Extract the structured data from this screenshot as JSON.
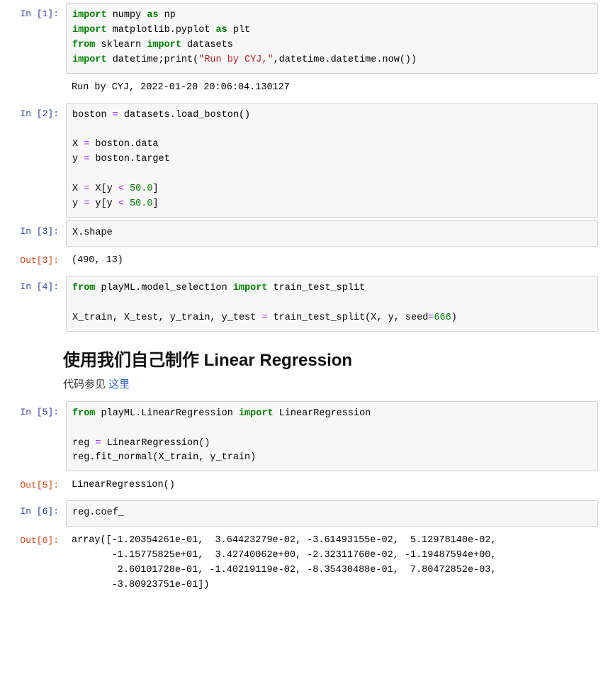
{
  "cells": {
    "c1": {
      "prompt": "In  [1]:",
      "code_html": "<span class='kw'>import</span> numpy <span class='kw'>as</span> np\n<span class='kw'>import</span> matplotlib.pyplot <span class='kw'>as</span> plt\n<span class='kw'>from</span> sklearn <span class='kw'>import</span> datasets\n<span class='kw'>import</span> datetime;print(<span class='str'>\"Run by CYJ,\"</span>,datetime.datetime.now())",
      "output": "Run by CYJ, 2022-01-20 20:06:04.130127"
    },
    "c2": {
      "prompt": "In  [2]:",
      "code_html": "boston <span class='op'>=</span> datasets.load_boston()\n\nX <span class='op'>=</span> boston.data\ny <span class='op'>=</span> boston.target\n\nX <span class='op'>=</span> X[y <span class='op'>&lt;</span> <span class='num'>50.0</span>]\ny <span class='op'>=</span> y[y <span class='op'>&lt;</span> <span class='num'>50.0</span>]"
    },
    "c3": {
      "prompt": "In  [3]:",
      "code_html": "X.shape",
      "out_prompt": "Out[3]:",
      "output": "(490, 13)"
    },
    "c4": {
      "prompt": "In  [4]:",
      "code_html": "<span class='kw'>from</span> playML.model_selection <span class='kw'>import</span> train_test_split\n\nX_train, X_test, y_train, y_test <span class='op'>=</span> train_test_split(X, y, seed<span class='op'>=</span><span class='num'>666</span>)"
    },
    "md1": {
      "heading": "使用我们自己制作 Linear Regression",
      "para_prefix": "代码参见 ",
      "link_text": "这里"
    },
    "c5": {
      "prompt": "In  [5]:",
      "code_html": "<span class='kw'>from</span> playML.LinearRegression <span class='kw'>import</span> LinearRegression\n\nreg <span class='op'>=</span> LinearRegression()\nreg.fit_normal(X_train, y_train)",
      "out_prompt": "Out[5]:",
      "output": "LinearRegression()"
    },
    "c6": {
      "prompt": "In  [6]:",
      "code_html": "reg.coef_",
      "out_prompt": "Out[6]:",
      "output": "array([-1.20354261e-01,  3.64423279e-02, -3.61493155e-02,  5.12978140e-02,\n       -1.15775825e+01,  3.42740062e+00, -2.32311760e-02, -1.19487594e+00,\n        2.60101728e-01, -1.40219119e-02, -8.35430488e-01,  7.80472852e-03,\n       -3.80923751e-01])"
    }
  }
}
